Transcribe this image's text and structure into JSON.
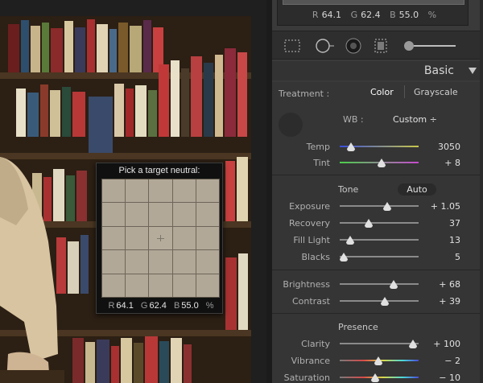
{
  "loupe": {
    "title": "Pick a target neutral:",
    "r_label": "R",
    "r_value": "64.1",
    "g_label": "G",
    "g_value": "62.4",
    "b_label": "B",
    "b_value": "55.0",
    "unit": "%"
  },
  "histogram": {
    "r_label": "R",
    "r_value": "64.1",
    "g_label": "G",
    "g_value": "62.4",
    "b_label": "B",
    "b_value": "55.0",
    "unit": "%"
  },
  "tools": {
    "items": [
      "crop-overlay-icon",
      "spot-removal-icon",
      "red-eye-icon",
      "graduated-filter-icon",
      "adjustment-brush-icon"
    ]
  },
  "panel": {
    "title": "Basic",
    "treatment_label": "Treatment :",
    "treatment_color": "Color",
    "treatment_grayscale": "Grayscale",
    "wb_label": "WB :",
    "wb_value": "Custom ÷",
    "tone_label": "Tone",
    "auto_label": "Auto",
    "presence_label": "Presence"
  },
  "sliders": {
    "temp": {
      "label": "Temp",
      "value": "3050",
      "position": 0.14
    },
    "tint": {
      "label": "Tint",
      "value": "+ 8",
      "position": 0.53
    },
    "exposure": {
      "label": "Exposure",
      "value": "+ 1.05",
      "position": 0.6
    },
    "recovery": {
      "label": "Recovery",
      "value": "37",
      "position": 0.37
    },
    "fill_light": {
      "label": "Fill Light",
      "value": "13",
      "position": 0.13
    },
    "blacks": {
      "label": "Blacks",
      "value": "5",
      "position": 0.05
    },
    "brightness": {
      "label": "Brightness",
      "value": "+ 68",
      "position": 0.68
    },
    "contrast": {
      "label": "Contrast",
      "value": "+ 39",
      "position": 0.57
    },
    "clarity": {
      "label": "Clarity",
      "value": "+ 100",
      "position": 0.93
    },
    "vibrance": {
      "label": "Vibrance",
      "value": "− 2",
      "position": 0.49
    },
    "saturation": {
      "label": "Saturation",
      "value": "− 10",
      "position": 0.45
    }
  },
  "colors": {
    "panel_bg": "#353535",
    "loupe_swatch": "#b2a898",
    "text_active": "#ffffff"
  }
}
